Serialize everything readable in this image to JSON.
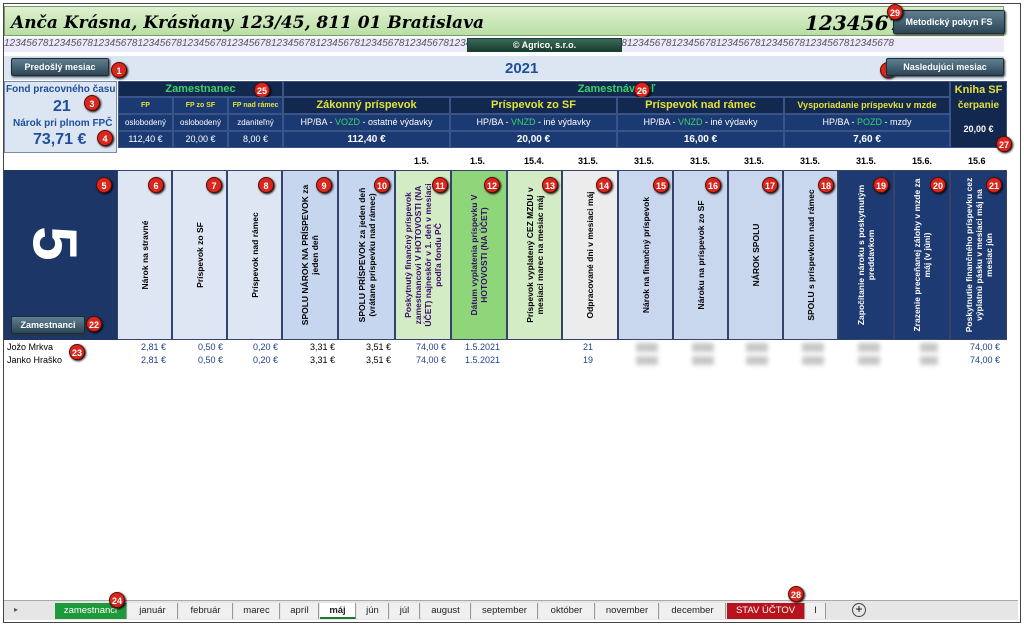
{
  "header": {
    "address": "Anča Krásna, Krásňany 123/45, 811 01 Bratislava",
    "ico": "12345678",
    "method_button": "Metodický pokyn FS",
    "pattern_text": "12345678",
    "company": "© Agrico, s.r.o."
  },
  "nav": {
    "prev": "Predošlý mesiac",
    "next": "Nasledujúci mesiac",
    "year": "2021"
  },
  "left": {
    "fund_label": "Fond pracovného času",
    "fund_value": "21",
    "claim_label": "Nárok pri plnom FPČ",
    "claim_value": "73,71 €"
  },
  "employee": {
    "title": "Zamestnanec",
    "cols": [
      "FP",
      "FP zo SF",
      "FP nad rámec"
    ],
    "tax": [
      "oslobodený",
      "oslobodený",
      "zdaniteľný"
    ],
    "vals": [
      "112,40 €",
      "20,00 €",
      "8,00 €"
    ]
  },
  "employer": {
    "title": "Zamestnávateľ",
    "groups": [
      {
        "title": "Zákonný príspevok",
        "pre": "HP/BA - ",
        "code": "VOZD",
        "post": " - ostatné výdavky",
        "val": "112,40 €"
      },
      {
        "title": "Príspevok zo SF",
        "pre": "HP/BA - ",
        "code": "VNZD",
        "post": " - iné výdavky",
        "val": "20,00 €"
      },
      {
        "title": "Príspevok nad rámec",
        "pre": "HP/BA - ",
        "code": "VNZD",
        "post": " - iné výdavky",
        "val": "16,00 €"
      },
      {
        "title": "Vysporiadanie príspevku v mzde",
        "pre": "HP/BA - ",
        "code": "POZD",
        "post": " - mzdy",
        "val": "7,60 €"
      }
    ],
    "sf_title": "Kniha SF",
    "sf_sub": "čerpanie",
    "sf_val": "20,00 €"
  },
  "month_number": "5",
  "employee_button": "Zamestnanci",
  "dates": [
    "1.5.",
    "1.5.",
    "15.4.",
    "31.5.",
    "31.5.",
    "31.5.",
    "31.5.",
    "31.5.",
    "31.5.",
    "15.6.",
    "15.6"
  ],
  "columns": [
    "Nárok na stravné",
    "Príspevok zo SF",
    "Príspevok nad rámec",
    "SPOLU NÁROK NA PRÍSPEVOK za jeden deň",
    "SPOLU PRÍSPEVOK za jeden deň (vrátane príspevku nad rámec)",
    "Poskytnutý finančný príspevok zamestnancovi V HOTOVOSTI (NA ÚČET) najneskôr v 1. deň v mesiaci podľa fondu PČ",
    "Dátum vyplatenia príspevku V HOTOVOSTI (NA ÚČET)",
    "Príspevok vyplatený CEZ MZDU v mesiaci marec na mesiac máj",
    "Odpracované dni v mesiaci máj",
    "Nárok na finančný príspevok",
    "Nároku na príspevok zo SF",
    "NÁROK SPOLU",
    "SPOLU s príspevkom nad rámec",
    "Započítanie nároku s poskytnutým preddavkom",
    "Zrazenie preceňanej zálohy v mzde za máj (v júni)",
    "Poskytnutie finančného príspevku cez výplatnú pásku v mesiaci máj na mesiac jún"
  ],
  "rows": [
    {
      "name": "Jožo Mrkva",
      "c1": "2,81 €",
      "c2": "0,50 €",
      "c3": "0,20 €",
      "c4": "3,31 €",
      "c5": "3,51 €",
      "c6": "74,00 €",
      "c7": "1.5.2021",
      "c9": "21",
      "c16": "74,00 €"
    },
    {
      "name": "Janko Hraško",
      "c1": "2,81 €",
      "c2": "0,50 €",
      "c3": "0,20 €",
      "c4": "3,31 €",
      "c5": "3,51 €",
      "c6": "74,00 €",
      "c7": "1.5.2021",
      "c9": "19",
      "c16": "74,00 €"
    }
  ],
  "tabs": [
    "zamestnanci",
    "január",
    "február",
    "marec",
    "apríl",
    "máj",
    "jún",
    "júl",
    "august",
    "september",
    "október",
    "november",
    "december",
    "STAV ÚČTOV",
    "I"
  ],
  "markers": [
    "1",
    "2",
    "3",
    "4",
    "5",
    "6",
    "7",
    "8",
    "9",
    "10",
    "11",
    "12",
    "13",
    "14",
    "15",
    "16",
    "17",
    "18",
    "19",
    "20",
    "21",
    "22",
    "23",
    "24",
    "25",
    "26",
    "27",
    "28",
    "29"
  ]
}
